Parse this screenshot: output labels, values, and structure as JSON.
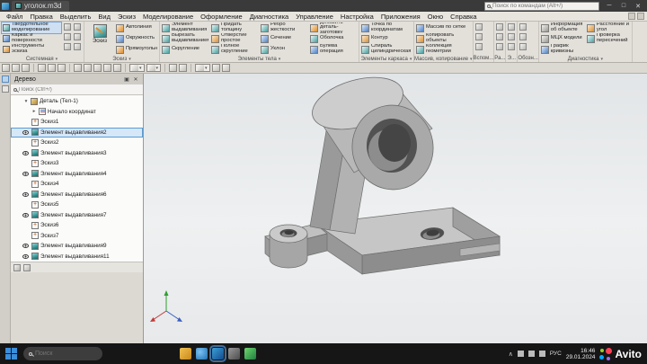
{
  "titlebar": {
    "tab": "уголок.m3d"
  },
  "menubar": {
    "items": [
      "Файл",
      "Правка",
      "Выделить",
      "Вид",
      "Эскиз",
      "Моделирование",
      "Оформление",
      "Диагностика",
      "Управление",
      "Настройка",
      "Приложения",
      "Окно",
      "Справка"
    ]
  },
  "command_search": {
    "placeholder": "Поиск по командам (Alt+/)"
  },
  "ribbon": {
    "modes": [
      {
        "label": "Твердотельное моделирование",
        "icon": "solid-modeling-icon"
      },
      {
        "label": "Каркас и поверхности",
        "icon": "wireframe-surfaces-icon"
      },
      {
        "label": "Инструменты эскиза",
        "icon": "sketch-tools-icon"
      }
    ],
    "groups": {
      "system": {
        "label": "Системная"
      },
      "sketch": {
        "label": "Эскиз",
        "main": "Эскиз",
        "items": [
          "Автолиния",
          "Окружность",
          "Прямоугольник"
        ]
      },
      "body": {
        "label": "Элементы тела",
        "items": [
          "Элемент выдавливания",
          "Вырезать выдавливанием",
          "Скругление",
          "Придать толщину",
          "Отверстие простое",
          "Полное скругление",
          "Ребро жесткости",
          "Сечение",
          "Уклон",
          "Добавить деталь-заготовку",
          "Оболочка",
          "Булева операция"
        ]
      },
      "frame": {
        "label": "Элементы каркаса",
        "items": [
          "Точка по координатам",
          "Контур",
          "Спираль цилиндрическая"
        ]
      },
      "array": {
        "label": "Массив, копирование",
        "items": [
          "Массив по сетке",
          "Копировать объекты",
          "Коллекция геометрии"
        ]
      },
      "aux": {
        "labels": [
          "Вспом...",
          "Ра...",
          "Э...",
          "Обозн..."
        ]
      },
      "diag": {
        "label": "Диагностика",
        "items": [
          "Информация об объекте",
          "МЦХ модели",
          "График кривизны",
          "Расстояние и угол",
          "Проверка пересечений"
        ]
      }
    }
  },
  "viewbar": {
    "icons": [
      "open-icon",
      "save-icon",
      "print-icon",
      "undo-icon",
      "redo-icon",
      "refresh-icon",
      "pan-icon",
      "zoom-in-icon",
      "zoom-out-icon",
      "zoom-area-icon",
      "zoom-fit-icon",
      "orientation-dropdown",
      "display-mode-dropdown",
      "hide-objects-icon",
      "section-view-icon",
      "snap-dropdown",
      "grid-icon",
      "selection-filter-icon"
    ]
  },
  "tree": {
    "tab_title": "Дерево",
    "search_placeholder": "Поиск (Ctrl+/)",
    "root_label": "Деталь (Тел-1)",
    "origin_label": "Начало координат",
    "items": [
      {
        "label": "Эскиз1",
        "type": "sketch",
        "eye": false
      },
      {
        "label": "Элемент выдавливания2",
        "type": "extrude",
        "eye": true,
        "selected": true
      },
      {
        "label": "Эскиз2",
        "type": "sketch",
        "eye": false
      },
      {
        "label": "Элемент выдавливания3",
        "type": "extrude",
        "eye": true
      },
      {
        "label": "Эскиз3",
        "type": "sketch",
        "eye": false
      },
      {
        "label": "Элемент выдавливания4",
        "type": "extrude",
        "eye": true
      },
      {
        "label": "Эскиз4",
        "type": "sketch",
        "eye": false
      },
      {
        "label": "Элемент выдавливания6",
        "type": "extrude",
        "eye": true
      },
      {
        "label": "Эскиз5",
        "type": "sketch",
        "eye": false
      },
      {
        "label": "Элемент выдавливания7",
        "type": "extrude",
        "eye": true
      },
      {
        "label": "Эскиз6",
        "type": "sketch",
        "eye": false
      },
      {
        "label": "Эскиз7",
        "type": "sketch",
        "eye": false
      },
      {
        "label": "Элемент выдавливания9",
        "type": "extrude",
        "eye": true
      },
      {
        "label": "Элемент выдавливания11",
        "type": "extrude",
        "eye": true
      }
    ]
  },
  "taskbar": {
    "search_placeholder": "Поиск",
    "lang": "РУС",
    "time": "16:46",
    "date": "29.01.2024",
    "brand": "Avito"
  }
}
